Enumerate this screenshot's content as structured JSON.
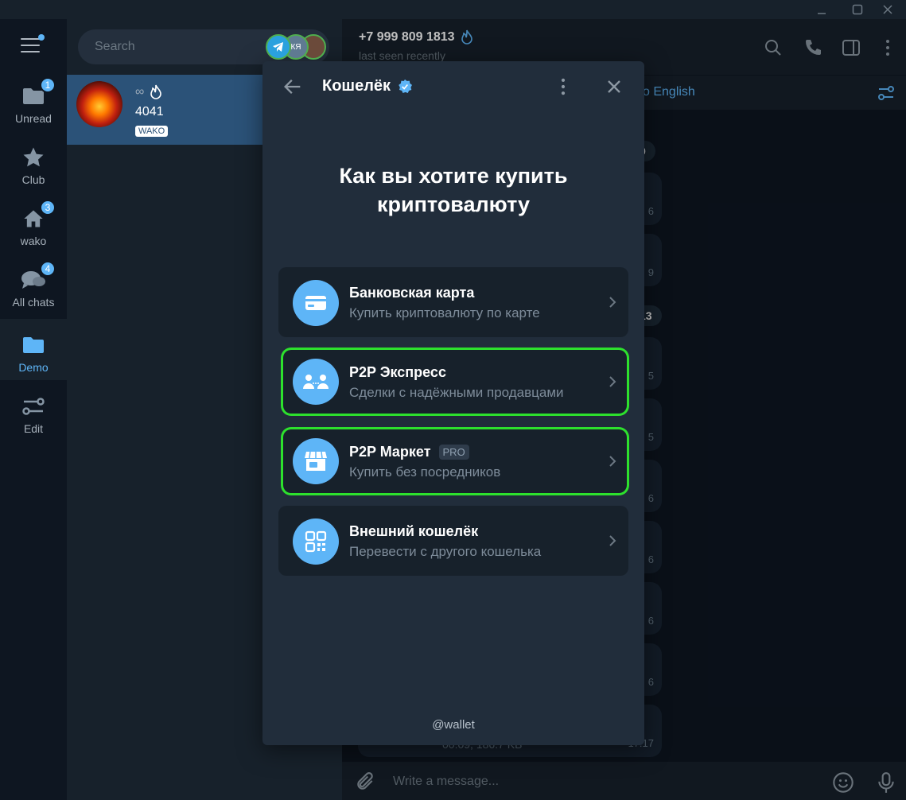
{
  "rail": {
    "items": [
      {
        "label": "Unread",
        "badge": "1"
      },
      {
        "label": "Club",
        "badge": ""
      },
      {
        "label": "wako",
        "badge": "3"
      },
      {
        "label": "All chats",
        "badge": "4"
      },
      {
        "label": "Demo",
        "badge": ""
      },
      {
        "label": "Edit",
        "badge": ""
      }
    ]
  },
  "search": {
    "placeholder": "Search",
    "avatar_text": "КЯ"
  },
  "chat": {
    "name_symbol": "∞",
    "subtitle": "4041",
    "tag": "WAKO"
  },
  "header": {
    "title": "+7 999 809 1813",
    "status": "last seen recently"
  },
  "translate": {
    "text": "o English"
  },
  "messages": {
    "date_pills": [
      "9",
      "13"
    ],
    "times": [
      "6",
      "9",
      "5",
      "5",
      "6",
      "6",
      "6",
      "6",
      "17:17"
    ],
    "last_meta": "00:09, 186.7 KB"
  },
  "composer": {
    "placeholder": "Write a message..."
  },
  "modal": {
    "title": "Кошелёк",
    "heading": "Как вы хотите купить криптовалюту",
    "options": [
      {
        "title": "Банковская карта",
        "subtitle": "Купить криптовалюту по карте",
        "icon": "card-icon"
      },
      {
        "title": "P2P Экспресс",
        "subtitle": "Сделки с надёжными продавцами",
        "icon": "people-icon"
      },
      {
        "title": "P2P Маркет",
        "badge": "PRO",
        "subtitle": "Купить без посредников",
        "icon": "store-icon"
      },
      {
        "title": "Внешний кошелёк",
        "subtitle": "Перевести с другого кошелька",
        "icon": "qr-icon"
      }
    ],
    "footer": "@wallet"
  },
  "colors": {
    "accent": "#5eb5f7",
    "highlight": "#2de12d",
    "modal_bg": "#212d3b"
  }
}
